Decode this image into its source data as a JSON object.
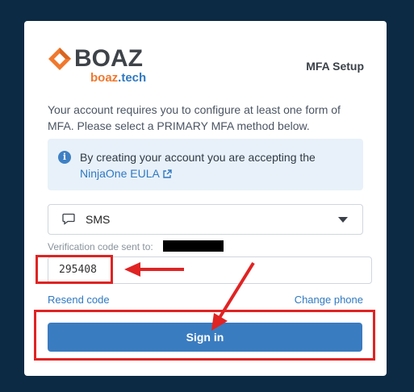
{
  "logo": {
    "word": "BOAZ",
    "sub_a": "boaz",
    "sub_b": ".tech"
  },
  "page_title": "MFA Setup",
  "intro_text": "Your account requires you to configure at least one form of MFA. Please select a PRIMARY MFA method below.",
  "info": {
    "text": "By creating your account you are accepting the",
    "link": "NinjaOne EULA",
    "icon": "info-icon"
  },
  "mfa_select": {
    "value": "SMS",
    "icon": "chat-icon"
  },
  "verification": {
    "label": "Verification code sent to:",
    "value": "295408"
  },
  "links": {
    "resend": "Resend code",
    "change_phone": "Change phone"
  },
  "signin_label": "Sign in",
  "colors": {
    "background": "#0d2a44",
    "accent": "#3a7cc0",
    "highlight": "#e02323",
    "brand_orange": "#f0782d"
  }
}
